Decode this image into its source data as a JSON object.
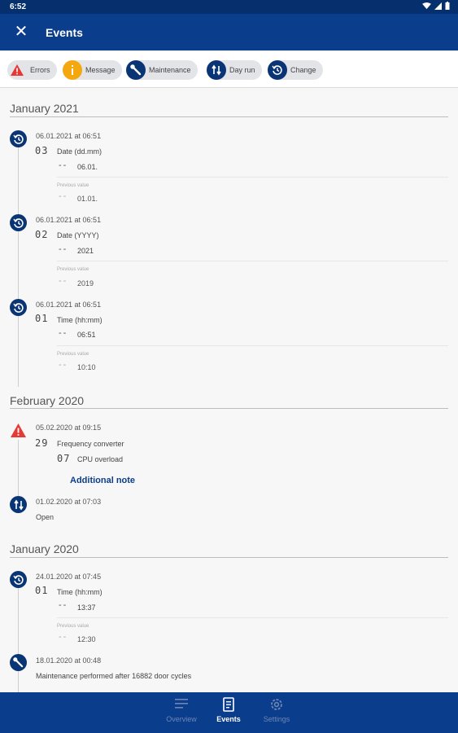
{
  "status": {
    "time": "6:52"
  },
  "appbar": {
    "title": "Events",
    "close_icon": "close-icon"
  },
  "filters": [
    {
      "label": "Errors",
      "icon": "warning-icon"
    },
    {
      "label": "Message",
      "icon": "info-icon"
    },
    {
      "label": "Maintenance",
      "icon": "wrench-icon"
    },
    {
      "label": "Day run",
      "icon": "swap-icon"
    },
    {
      "label": "Change",
      "icon": "history-icon"
    }
  ],
  "sections": [
    {
      "month": "January 2021",
      "events": [
        {
          "datetime": "06.01.2021 at 06:51",
          "code": "03",
          "param": "Date (dd.mm)",
          "value": "06.01.",
          "prev_label": "Previous value",
          "prev_value": "01.01."
        },
        {
          "datetime": "06.01.2021 at 06:51",
          "code": "02",
          "param": "Date (YYYY)",
          "value": "2021",
          "prev_label": "Previous value",
          "prev_value": "2019"
        },
        {
          "datetime": "06.01.2021 at 06:51",
          "code": "01",
          "param": "Time (hh:mm)",
          "value": "06:51",
          "prev_label": "Previous value",
          "prev_value": "10:10"
        }
      ]
    },
    {
      "month": "February 2020",
      "events": [
        {
          "datetime": "05.02.2020 at 09:15",
          "code": "29",
          "param": "Frequency converter",
          "subcode": "07",
          "subtext": "CPU overload",
          "note": "Additional note"
        },
        {
          "datetime": "01.02.2020 at 07:03",
          "text": "Open"
        }
      ]
    },
    {
      "month": "January 2020",
      "events": [
        {
          "datetime": "24.01.2020 at 07:45",
          "code": "01",
          "param": "Time (hh:mm)",
          "value": "13:37",
          "prev_label": "Previous value",
          "prev_value": "12:30"
        },
        {
          "datetime": "18.01.2020 at 00:48",
          "text": "Maintenance performed after 16882 door cycles"
        }
      ]
    }
  ],
  "dash": "--",
  "bottom_nav": [
    {
      "label": "Overview",
      "active": false
    },
    {
      "label": "Events",
      "active": true
    },
    {
      "label": "Settings",
      "active": false
    }
  ],
  "colors": {
    "primary": "#0a3d8c",
    "status_bar": "#062f6e",
    "icon_navy": "#0a3575",
    "error": "#e53935",
    "message": "#f4a80e",
    "link": "#0a3d8c"
  }
}
